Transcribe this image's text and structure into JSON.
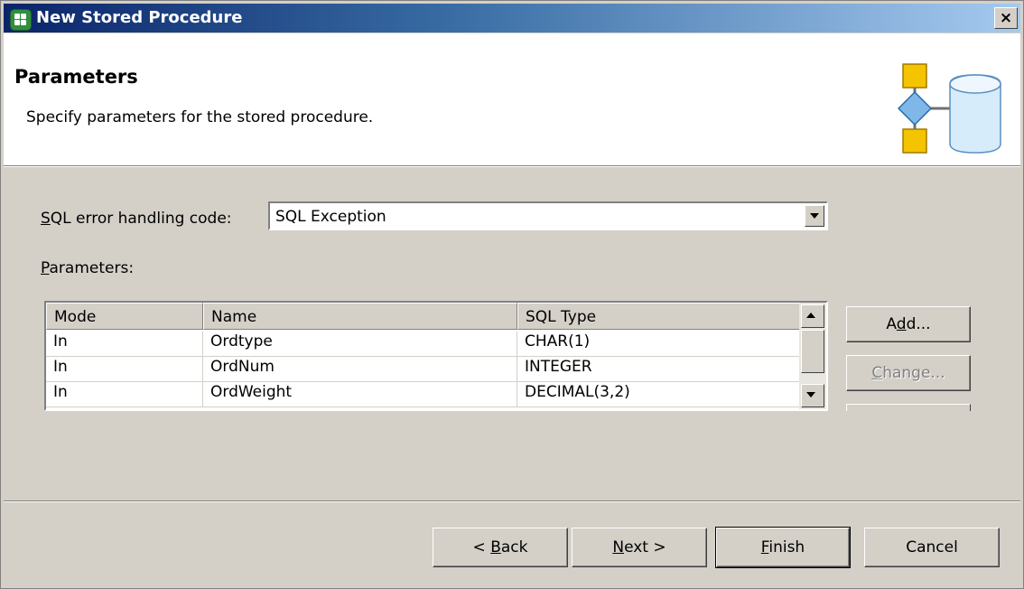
{
  "window": {
    "title": "New Stored Procedure",
    "close_label": "×"
  },
  "header": {
    "title": "Parameters",
    "description": "Specify parameters for the stored procedure."
  },
  "error_handling": {
    "label_mnemonic": "S",
    "label_rest": "QL error handling code:",
    "value": "SQL Exception"
  },
  "parameters": {
    "label_mnemonic": "P",
    "label_rest": "arameters:",
    "columns": [
      "Mode",
      "Name",
      "SQL Type"
    ],
    "rows": [
      {
        "mode": "In",
        "name": "Ordtype",
        "sql_type": "CHAR(1)"
      },
      {
        "mode": "In",
        "name": "OrdNum",
        "sql_type": "INTEGER"
      },
      {
        "mode": "In",
        "name": "OrdWeight",
        "sql_type": "DECIMAL(3,2)"
      }
    ]
  },
  "side_buttons": {
    "add_pre": "A",
    "add_mnemonic": "d",
    "add_post": "d...",
    "change_mnemonic": "C",
    "change_post": "hange..."
  },
  "footer": {
    "back_pre": "< ",
    "back_mnemonic": "B",
    "back_post": "ack",
    "next_mnemonic": "N",
    "next_post": "ext >",
    "finish_mnemonic": "F",
    "finish_post": "inish",
    "cancel": "Cancel"
  }
}
